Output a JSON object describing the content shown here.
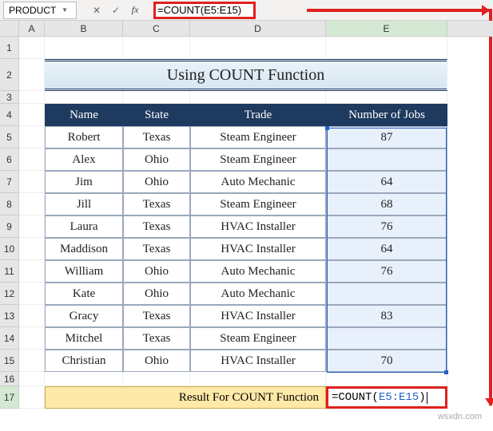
{
  "nameBox": {
    "value": "PRODUCT"
  },
  "formulaBar": {
    "value": "=COUNT(E5:E15)"
  },
  "columns": [
    "",
    "A",
    "B",
    "C",
    "D",
    "E"
  ],
  "title": "Using COUNT Function",
  "headers": {
    "name": "Name",
    "state": "State",
    "trade": "Trade",
    "jobs": "Number of Jobs"
  },
  "rows": [
    {
      "n": 5,
      "name": "Robert",
      "state": "Texas",
      "trade": "Steam Engineer",
      "jobs": "87"
    },
    {
      "n": 6,
      "name": "Alex",
      "state": "Ohio",
      "trade": "Steam Engineer",
      "jobs": ""
    },
    {
      "n": 7,
      "name": "Jim",
      "state": "Ohio",
      "trade": "Auto Mechanic",
      "jobs": "64"
    },
    {
      "n": 8,
      "name": "Jill",
      "state": "Texas",
      "trade": "Steam Engineer",
      "jobs": "68"
    },
    {
      "n": 9,
      "name": "Laura",
      "state": "Texas",
      "trade": "HVAC Installer",
      "jobs": "76"
    },
    {
      "n": 10,
      "name": "Maddison",
      "state": "Texas",
      "trade": "HVAC Installer",
      "jobs": "64"
    },
    {
      "n": 11,
      "name": "William",
      "state": "Ohio",
      "trade": "Auto Mechanic",
      "jobs": "76"
    },
    {
      "n": 12,
      "name": "Kate",
      "state": "Ohio",
      "trade": "Auto Mechanic",
      "jobs": ""
    },
    {
      "n": 13,
      "name": "Gracy",
      "state": "Texas",
      "trade": "HVAC Installer",
      "jobs": "83"
    },
    {
      "n": 14,
      "name": "Mitchel",
      "state": "Texas",
      "trade": "Steam Engineer",
      "jobs": ""
    },
    {
      "n": 15,
      "name": "Christian",
      "state": "Ohio",
      "trade": "HVAC Installer",
      "jobs": "70"
    }
  ],
  "resultLabel": "Result For COUNT Function",
  "resultFormula": {
    "prefix": "=COUNT(",
    "range": "E5:E15",
    "suffix": ")"
  },
  "watermark": "wsxdn.com"
}
